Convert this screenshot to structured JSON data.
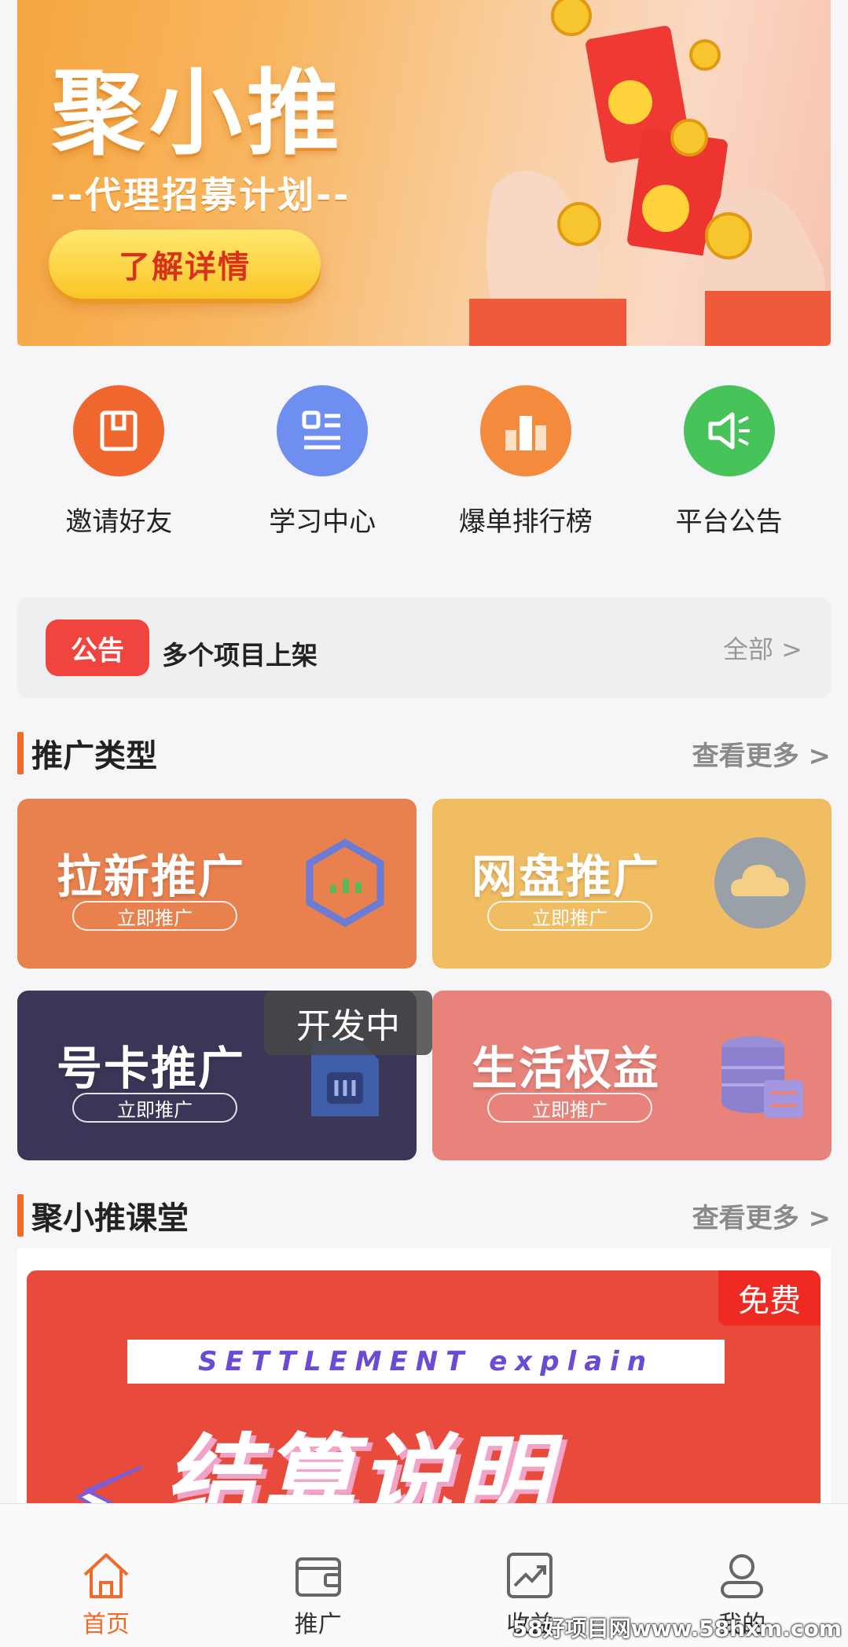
{
  "banner": {
    "title": "聚小推",
    "subtitle": "--代理招募计划--",
    "button": "了解详情"
  },
  "quicknav": [
    {
      "label": "邀请好友",
      "icon": "book-icon",
      "color": "#f0662f"
    },
    {
      "label": "学习中心",
      "icon": "list-icon",
      "color": "#6f8ff0"
    },
    {
      "label": "爆单排行榜",
      "icon": "bar-chart-icon",
      "color": "#f48b3c"
    },
    {
      "label": "平台公告",
      "icon": "speaker-icon",
      "color": "#47c35a"
    }
  ],
  "notice": {
    "badge": "公告",
    "text": "多个项目上架",
    "more": "全部 >"
  },
  "promo": {
    "section_title": "推广类型",
    "more": "查看更多 >",
    "cards": [
      {
        "title": "拉新推广",
        "button": "立即推广",
        "color": "#e9814f",
        "icon": "hexagon-chart-icon"
      },
      {
        "title": "网盘推广",
        "button": "立即推广",
        "color": "#f1bd62",
        "icon": "cloud-icon"
      },
      {
        "title": "号卡推广",
        "button": "立即推广",
        "color": "#3b3658",
        "icon": "sim-card-icon"
      },
      {
        "title": "生活权益",
        "button": "立即推广",
        "color": "#e7837a",
        "icon": "coins-icon"
      }
    ],
    "dev_tag": "开发中"
  },
  "classroom": {
    "section_title": "聚小推课堂",
    "more": "查看更多 >",
    "free_tag": "免费",
    "strip": "SETTLEMENT explain",
    "title": "结算说明"
  },
  "tabbar": [
    {
      "label": "首页",
      "icon": "home-icon",
      "active": true
    },
    {
      "label": "推广",
      "icon": "wallet-icon",
      "active": false
    },
    {
      "label": "收益",
      "icon": "trend-icon",
      "active": false
    },
    {
      "label": "我的",
      "icon": "user-icon",
      "active": false
    }
  ],
  "watermark": "58好项目网www.58hxm.com"
}
